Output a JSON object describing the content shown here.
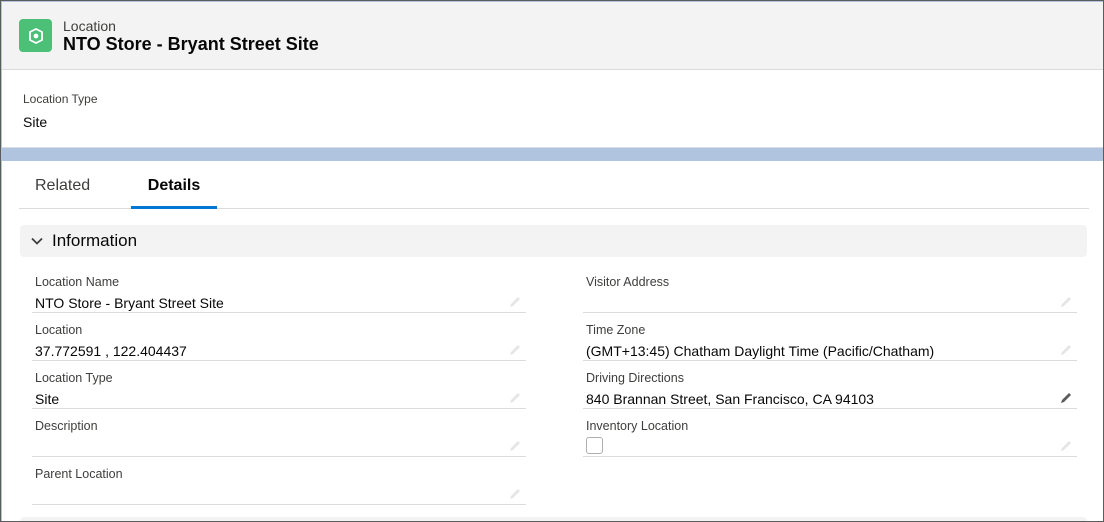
{
  "header": {
    "object_label": "Location",
    "record_title": "NTO Store - Bryant Street Site",
    "object_icon": "location-icon",
    "icon_color": "#4bc076"
  },
  "highlights": {
    "label": "Location Type",
    "value": "Site"
  },
  "tabs": [
    {
      "label": "Related",
      "active": false
    },
    {
      "label": "Details",
      "active": true
    }
  ],
  "accent_color": "#0176d3",
  "section": {
    "title": "Information",
    "expanded": true
  },
  "fields_left": [
    {
      "label": "Location Name",
      "value": "NTO Store - Bryant Street Site"
    },
    {
      "label": "Location",
      "value": "37.772591 , 122.404437"
    },
    {
      "label": "Location Type",
      "value": "Site"
    },
    {
      "label": "Description",
      "value": ""
    },
    {
      "label": "Parent Location",
      "value": ""
    }
  ],
  "fields_right": [
    {
      "label": "Visitor Address",
      "value": ""
    },
    {
      "label": "Time Zone",
      "value": "(GMT+13:45) Chatham Daylight Time (Pacific/Chatham)"
    },
    {
      "label": "Driving Directions",
      "value": "840 Brannan Street, San Francisco, CA 94103"
    },
    {
      "label": "Inventory Location",
      "value": "",
      "type": "checkbox",
      "checked": false
    }
  ]
}
